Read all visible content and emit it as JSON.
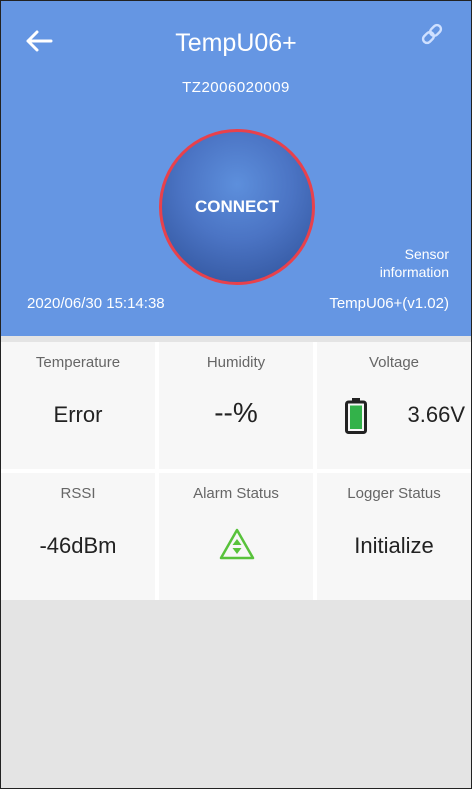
{
  "header": {
    "title": "TempU06+",
    "serial": "TZ2006020009",
    "connect_label": "CONNECT",
    "sensor_info_line1": "Sensor",
    "sensor_info_line2": "information",
    "datetime": "2020/06/30 15:14:38",
    "version": "TempU06+(v1.02)",
    "back_icon": "arrow-left-icon",
    "link_icon": "link-icon"
  },
  "cells": {
    "temperature": {
      "label": "Temperature",
      "value": "Error"
    },
    "humidity": {
      "label": "Humidity",
      "value": "--%"
    },
    "voltage": {
      "label": "Voltage",
      "value": "3.66V",
      "icon": "battery-icon"
    },
    "rssi": {
      "label": "RSSI",
      "value": "-46dBm"
    },
    "alarm": {
      "label": "Alarm Status",
      "icon": "alarm-triangle-icon"
    },
    "logger": {
      "label": "Logger Status",
      "value": "Initialize"
    }
  },
  "colors": {
    "header_bg": "#6596e3",
    "connect_ring": "#e8414c",
    "battery_green": "#33b24a",
    "alarm_green": "#58c23b"
  }
}
